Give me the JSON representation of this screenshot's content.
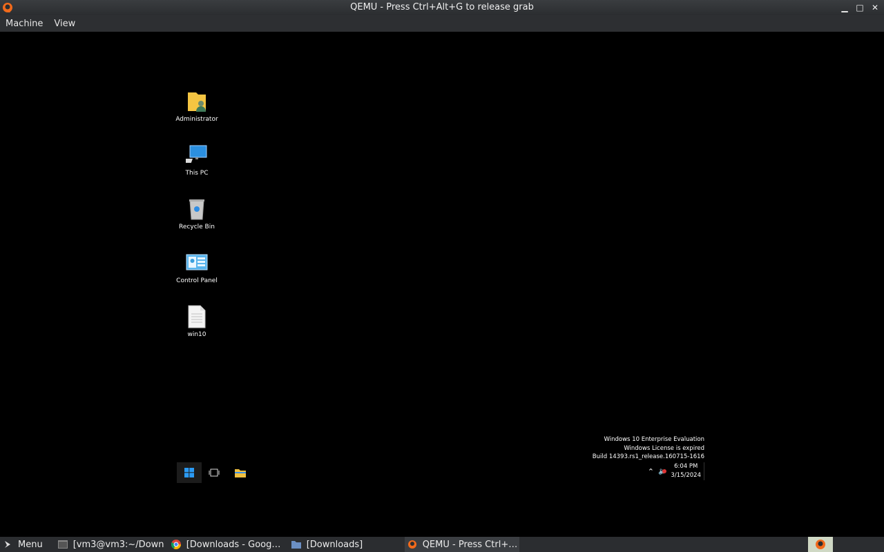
{
  "window": {
    "title": "QEMU - Press Ctrl+Alt+G to release grab",
    "app_icon": "qemu-icon",
    "controls": [
      "minimize",
      "maximize",
      "close"
    ]
  },
  "menubar": {
    "items": [
      "Machine",
      "View"
    ]
  },
  "guest": {
    "desktop_icons": [
      {
        "label": "Administrator",
        "icon": "user-folder-icon"
      },
      {
        "label": "This PC",
        "icon": "computer-icon"
      },
      {
        "label": "Recycle Bin",
        "icon": "recycle-bin-icon"
      },
      {
        "label": "Control Panel",
        "icon": "control-panel-icon"
      },
      {
        "label": "win10",
        "icon": "text-file-icon"
      }
    ],
    "watermark": {
      "line1": "Windows 10 Enterprise Evaluation",
      "line2": "Windows License is expired",
      "line3": "Build 14393.rs1_release.160715-1616"
    },
    "taskbar": {
      "buttons": [
        "windows-start-icon",
        "task-view-icon",
        "file-explorer-icon"
      ],
      "tray": {
        "time": "6:04 PM",
        "date": "3/15/2024"
      }
    }
  },
  "host_taskbar": {
    "menu_label": "Menu",
    "items": [
      {
        "label": "[vm3@vm3:~/Down…",
        "icon": "terminal-icon"
      },
      {
        "label": "[Downloads - Goog…",
        "icon": "chrome-icon"
      },
      {
        "label": "[Downloads]",
        "icon": "folder-icon"
      },
      {
        "label": "QEMU - Press Ctrl+…",
        "icon": "qemu-icon",
        "active": true
      }
    ]
  },
  "colors": {
    "accent_blue": "#1e90ff",
    "folder_yellow": "#f5c542"
  }
}
